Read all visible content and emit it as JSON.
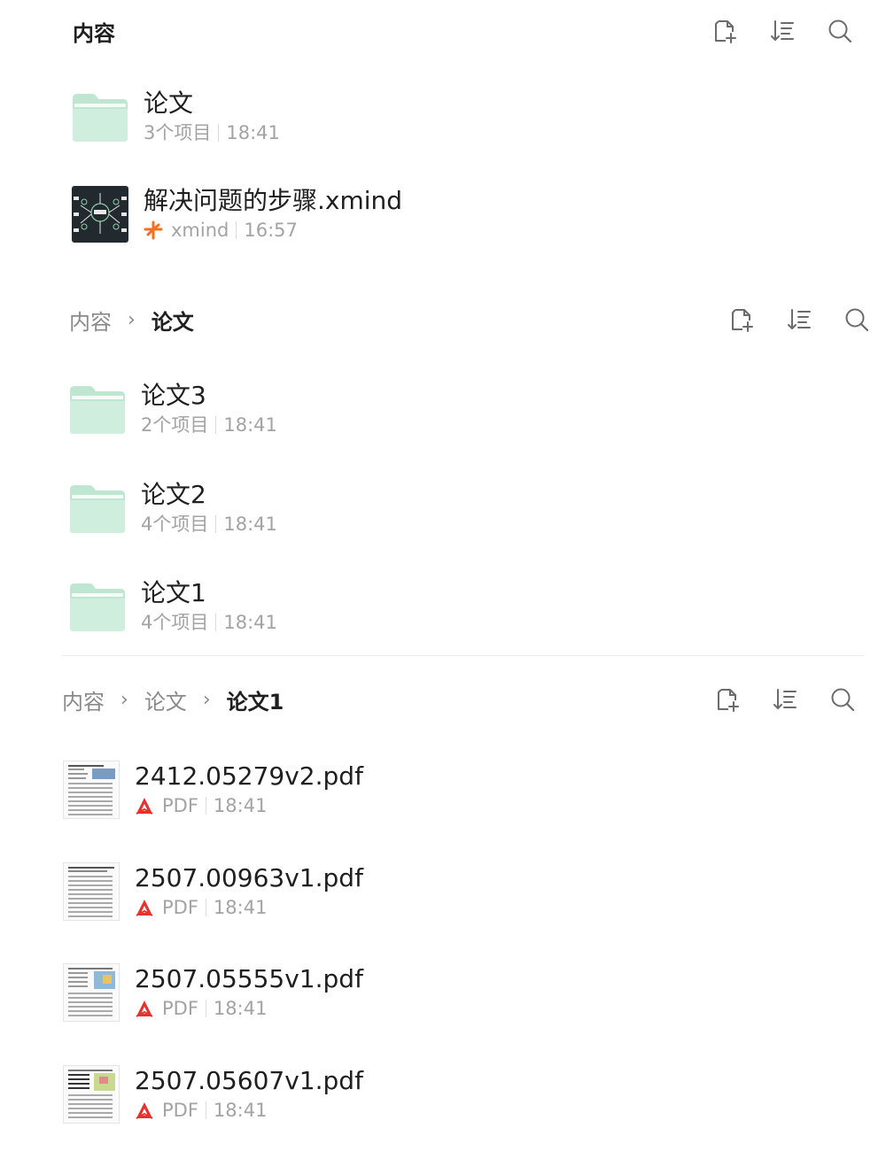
{
  "panels": [
    {
      "breadcrumbs": [
        {
          "label": "内容",
          "current": true
        }
      ],
      "items": [
        {
          "kind": "folder",
          "name": "论文",
          "count": "3个项目",
          "time": "18:41"
        },
        {
          "kind": "xmind",
          "name": "解决问题的步骤.xmind",
          "type_label": "xmind",
          "time": "16:57"
        }
      ]
    },
    {
      "breadcrumbs": [
        {
          "label": "内容",
          "current": false
        },
        {
          "label": "论文",
          "current": true
        }
      ],
      "items": [
        {
          "kind": "folder",
          "name": "论文3",
          "count": "2个项目",
          "time": "18:41"
        },
        {
          "kind": "folder",
          "name": "论文2",
          "count": "4个项目",
          "time": "18:41"
        },
        {
          "kind": "folder",
          "name": "论文1",
          "count": "4个项目",
          "time": "18:41"
        }
      ]
    },
    {
      "breadcrumbs": [
        {
          "label": "内容",
          "current": false
        },
        {
          "label": "论文",
          "current": false
        },
        {
          "label": "论文1",
          "current": true
        }
      ],
      "items": [
        {
          "kind": "pdf",
          "name": "2412.05279v2.pdf",
          "type_label": "PDF",
          "time": "18:41"
        },
        {
          "kind": "pdf",
          "name": "2507.00963v1.pdf",
          "type_label": "PDF",
          "time": "18:41"
        },
        {
          "kind": "pdf",
          "name": "2507.05555v1.pdf",
          "type_label": "PDF",
          "time": "18:41"
        },
        {
          "kind": "pdf",
          "name": "2507.05607v1.pdf",
          "type_label": "PDF",
          "time": "18:41"
        }
      ]
    }
  ],
  "breadcrumb_separator": "›",
  "icons": {
    "new_file": "new-file-icon",
    "sort": "sort-icon",
    "search": "search-icon"
  },
  "colors": {
    "folder": "#bfe6d0",
    "folder_tab": "#cfeedd",
    "pdf": "#e5322d",
    "xmind": "#f36f21",
    "text_primary": "#1f1f1f",
    "text_secondary": "#a3a3a3"
  }
}
